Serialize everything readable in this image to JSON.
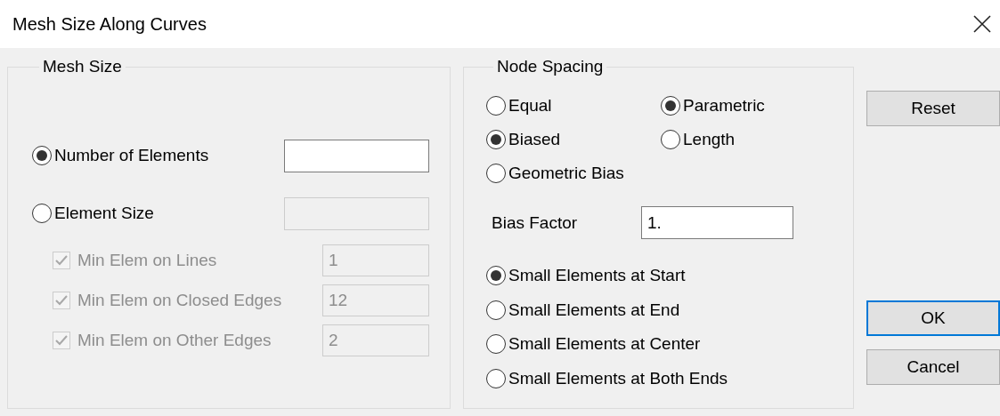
{
  "window": {
    "title": "Mesh Size Along Curves"
  },
  "mesh_size": {
    "title": "Mesh Size",
    "modes": [
      {
        "label": "Number of Elements",
        "selected": true,
        "field_disabled": false
      },
      {
        "label": "Element Size",
        "selected": false,
        "field_disabled": true
      }
    ],
    "minimums": [
      {
        "label": "Min Elem on Lines",
        "checked": true,
        "disabled": true,
        "value": "1"
      },
      {
        "label": "Min Elem on Closed Edges",
        "checked": true,
        "disabled": true,
        "value": "12"
      },
      {
        "label": "Min Elem on Other Edges",
        "checked": true,
        "disabled": true,
        "value": "2"
      }
    ]
  },
  "node_spacing": {
    "title": "Node Spacing",
    "spacing": [
      {
        "label": "Equal",
        "selected": false
      },
      {
        "label": "Biased",
        "selected": true
      },
      {
        "label": "Geometric Bias",
        "selected": false
      }
    ],
    "parameterization": [
      {
        "label": "Parametric",
        "selected": true
      },
      {
        "label": "Length",
        "selected": false
      }
    ],
    "bias_factor": {
      "label": "Bias Factor",
      "value": "1."
    },
    "bias_location": [
      {
        "label": "Small Elements at Start",
        "selected": true
      },
      {
        "label": "Small Elements at End",
        "selected": false
      },
      {
        "label": "Small Elements at Center",
        "selected": false
      },
      {
        "label": "Small Elements at Both Ends",
        "selected": false
      }
    ]
  },
  "buttons": [
    {
      "label": "Reset",
      "focused": false
    },
    {
      "label": "OK",
      "focused": true
    },
    {
      "label": "Cancel",
      "focused": false
    }
  ]
}
